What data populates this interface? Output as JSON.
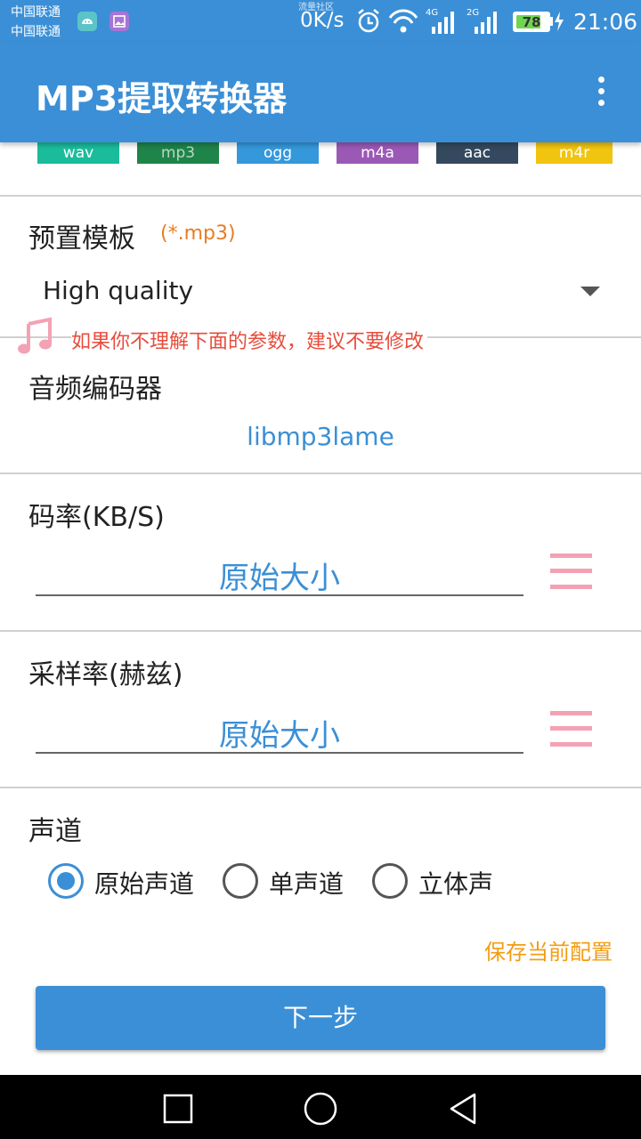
{
  "status_bar": {
    "carrier_1": "中国联通",
    "carrier_2": "中国联通",
    "speed_label_top": "流量社区",
    "speed": "0K/s",
    "network_4g": "4G",
    "network_2g": "2G",
    "battery": "78",
    "time": "21:06",
    "icons": [
      "android-icon",
      "gallery-icon",
      "alarm-icon",
      "wifi-icon",
      "signal-4g-icon",
      "signal-2g-icon",
      "battery-icon",
      "charging-icon"
    ]
  },
  "app_bar": {
    "title": "MP3提取转换器",
    "overflow_icon": "more-vert-icon"
  },
  "formats": [
    {
      "label": "wav",
      "color": "#1abc9c"
    },
    {
      "label": "mp3",
      "color": "#1e8449"
    },
    {
      "label": "ogg",
      "color": "#3498db"
    },
    {
      "label": "m4a",
      "color": "#9b59b6"
    },
    {
      "label": "aac",
      "color": "#34495e"
    },
    {
      "label": "m4r",
      "color": "#f1c40f"
    }
  ],
  "preset": {
    "title": "预置模板",
    "hint": "(*.mp3)",
    "selected": "High quality"
  },
  "warning": {
    "icon": "music-note-icon",
    "text": "如果你不理解下面的参数，建议不要修改"
  },
  "codec": {
    "title": "音频编码器",
    "value": "libmp3lame"
  },
  "bitrate": {
    "title": "码率(KB/S)",
    "value": "原始大小"
  },
  "sample_rate": {
    "title": "采样率(赫兹)",
    "value": "原始大小"
  },
  "channels": {
    "title": "声道",
    "options": [
      {
        "label": "原始声道",
        "checked": true
      },
      {
        "label": "单声道",
        "checked": false
      },
      {
        "label": "立体声",
        "checked": false
      }
    ]
  },
  "actions": {
    "save": "保存当前配置",
    "next": "下一步"
  },
  "colors": {
    "primary": "#3b8fd6",
    "accent_orange": "#f39c12",
    "warning_red": "#e74c3c",
    "menu_pink": "#f3a2b4"
  }
}
